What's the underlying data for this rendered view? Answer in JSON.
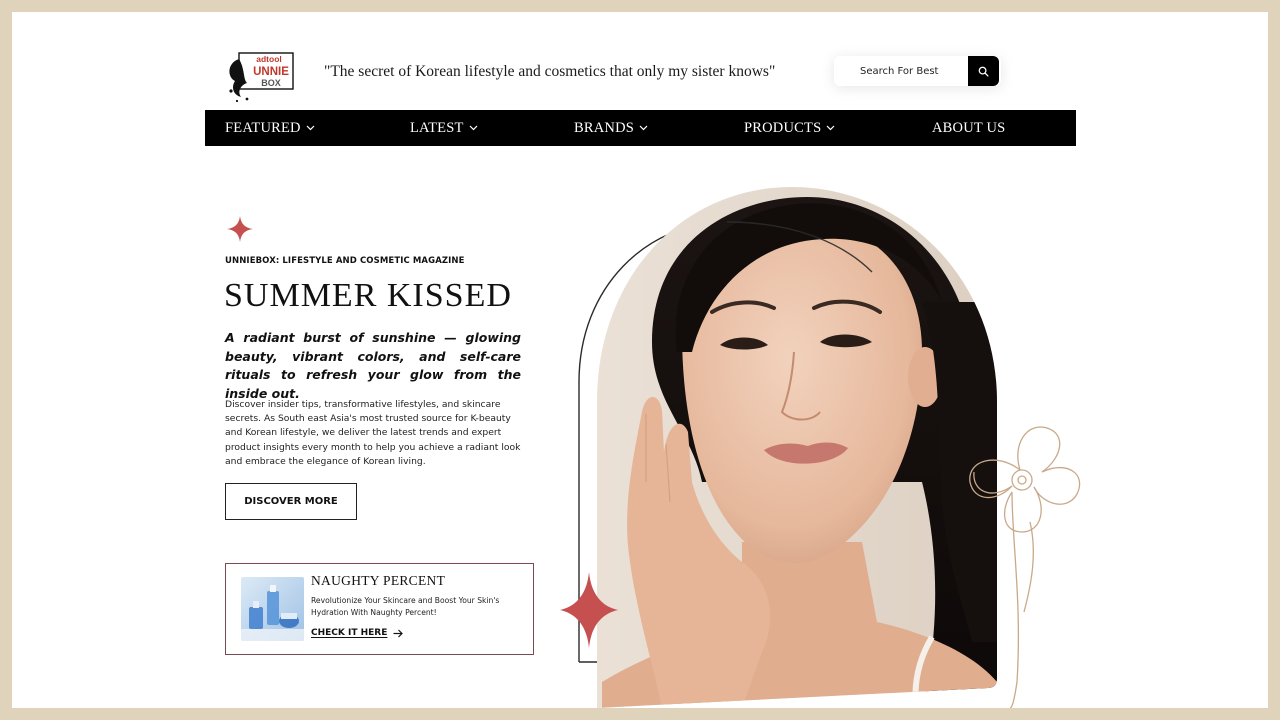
{
  "header": {
    "logo_text_top": "adtool",
    "logo_text_mid": "UNNIE",
    "logo_text_bot": "BOX",
    "tagline": "\"The secret of Korean lifestyle and cosmetics that only my sister knows\"",
    "search_placeholder": "Search For Best"
  },
  "nav": {
    "items": [
      {
        "label": "FEATURED"
      },
      {
        "label": "LATEST"
      },
      {
        "label": "BRANDS"
      },
      {
        "label": "PRODUCTS"
      },
      {
        "label": "ABOUT US"
      }
    ]
  },
  "hero": {
    "eyebrow": "UNNIEBOX: LIFESTYLE AND COSMETIC MAGAZINE",
    "headline": "SUMMER KISSED",
    "subhead": "A radiant burst of sunshine — glowing beauty, vibrant colors, and self-care rituals to refresh your glow from the inside out.",
    "body": "Discover insider tips, transformative lifestyles, and skincare secrets. As South east Asia's most trusted source for K-beauty and Korean lifestyle, we deliver the latest trends and expert product insights every month to help you achieve a radiant look and embrace the elegance of Korean living.",
    "cta_label": "DISCOVER MORE"
  },
  "promo": {
    "title": "NAUGHTY PERCENT",
    "description": "Revolutionize Your Skincare  and Boost Your Skin's Hydration With Naughty Percent!",
    "link_label": "CHECK IT HERE"
  },
  "colors": {
    "page_border": "#e0d3bc",
    "nav_bg": "#000000",
    "sparkle": "#c5504f",
    "promo_border": "#7a4a52",
    "flower_line": "#c9a98a"
  }
}
